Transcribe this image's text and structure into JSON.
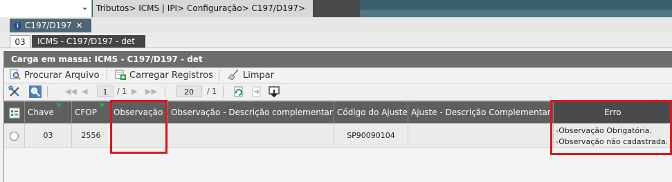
{
  "topbar": {
    "breadcrumb": "Tributos> ICMS | IPI> Configuração> C197/D197>"
  },
  "window_tab": {
    "label": "C197/D197",
    "close": "✕",
    "info": "i"
  },
  "subtabs": {
    "number": "03",
    "title": "ICMS - C197/D197 - det"
  },
  "panel": {
    "title": "Carga em massa: ICMS - C197/D197 - det"
  },
  "toolbar": {
    "search_file": "Procurar Arquivo",
    "load_records": "Carregar Registros",
    "clear": "Limpar"
  },
  "pager": {
    "page": "1",
    "of_pages": "/ 1",
    "page_size": "20",
    "of_size": "/ 1"
  },
  "grid": {
    "columns": [
      "Chave",
      "CFOP",
      "Observação",
      "Observação - Descrição complementar",
      "Código do Ajuste",
      "Ajuste - Descrição Complementar",
      "Erro"
    ],
    "rows": [
      {
        "chave": "03",
        "cfop": "2556",
        "observacao": "",
        "obs_desc": "",
        "codigo_ajuste": "SP90090104",
        "ajuste_desc": "",
        "erro_1": "-Observação Obrigatória.",
        "erro_2": "-Observação não cadastrada."
      }
    ]
  },
  "colors": {
    "highlight": "#e0141e",
    "header_bg": "#5f5f5f",
    "topbar_bg": "#3c5f6e"
  }
}
